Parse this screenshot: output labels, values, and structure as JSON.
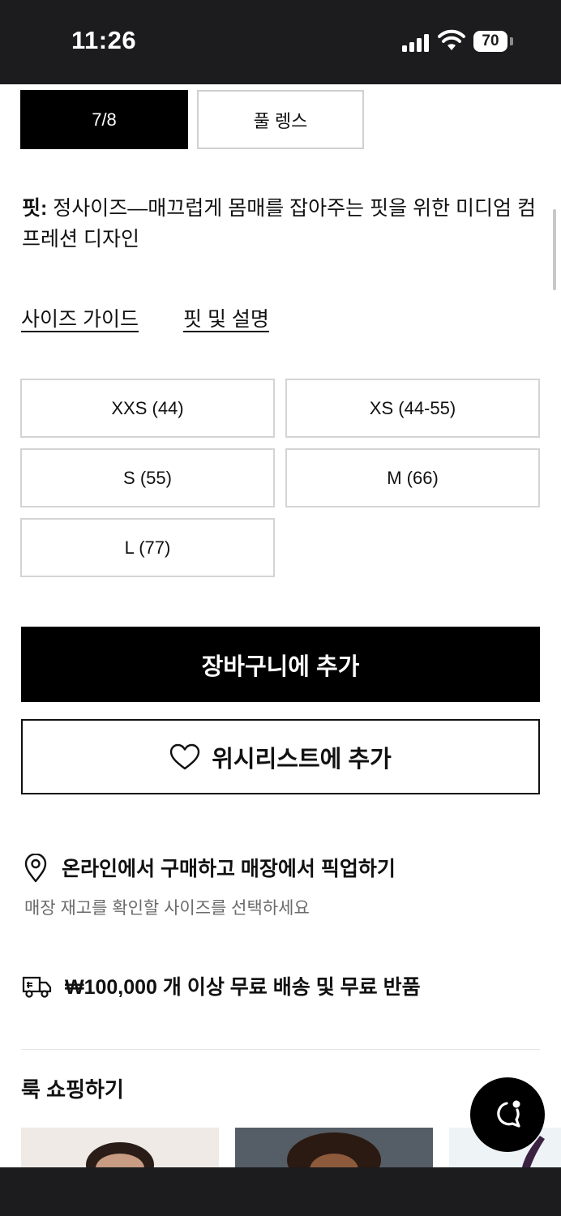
{
  "status_bar": {
    "time": "11:26",
    "battery": "70"
  },
  "length_options": {
    "selected": "7/8",
    "other": "풀 렝스"
  },
  "fit": {
    "label": "핏:",
    "text": "정사이즈—매끄럽게 몸매를 잡아주는 핏을 위한 미디엄 컴프레션 디자인"
  },
  "links": {
    "size_guide": "사이즈 가이드",
    "fit_details": "핏 및 설명"
  },
  "sizes": [
    "XXS (44)",
    "XS (44-55)",
    "S (55)",
    "M (66)",
    "L (77)"
  ],
  "actions": {
    "add_to_cart": "장바구니에 추가",
    "add_to_wishlist": "위시리스트에 추가"
  },
  "pickup": {
    "title": "온라인에서 구매하고 매장에서 픽업하기",
    "subtitle": "매장 재고를 확인할 사이즈를 선택하세요"
  },
  "shipping": {
    "text": "₩100,000 개 이상 무료 배송 및 무료 반품"
  },
  "shop_the_look": {
    "title": "룩 쇼핑하기"
  },
  "icons": {
    "location": "location-pin-icon",
    "shipping": "delivery-truck-icon",
    "wishlist": "heart-icon",
    "chat": "chat-bubble-icon"
  }
}
